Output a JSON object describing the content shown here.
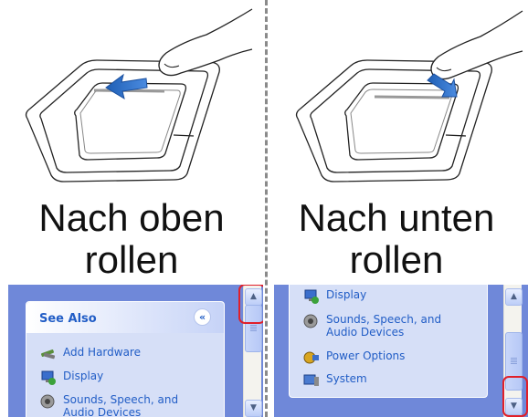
{
  "captions": {
    "left": {
      "line1": "Nach oben",
      "line2": "rollen"
    },
    "right": {
      "line1": "Nach unten",
      "line2": "rollen"
    }
  },
  "left_panel": {
    "header": "See Also",
    "collapse_glyph": "«",
    "items": [
      {
        "label": "Add Hardware",
        "icon": "add-hardware-icon"
      },
      {
        "label": "Display",
        "icon": "display-icon"
      },
      {
        "label": "Sounds, Speech, and",
        "label2": "Audio Devices",
        "icon": "sounds-icon"
      }
    ]
  },
  "right_panel": {
    "items": [
      {
        "label": "Display",
        "icon": "display-icon"
      },
      {
        "label": "Sounds, Speech, and",
        "label2": "Audio Devices",
        "icon": "sounds-icon"
      },
      {
        "label": "Power Options",
        "icon": "power-options-icon"
      },
      {
        "label": "System",
        "icon": "system-icon"
      }
    ]
  },
  "scroll": {
    "up_glyph": "▲",
    "down_glyph": "▼"
  },
  "colors": {
    "panel_bg": "#6f88d9",
    "task_box_bg": "#d6dff7",
    "link_text": "#215dc6",
    "highlight": "#e0202a",
    "arrow": "#1f5fb5"
  }
}
